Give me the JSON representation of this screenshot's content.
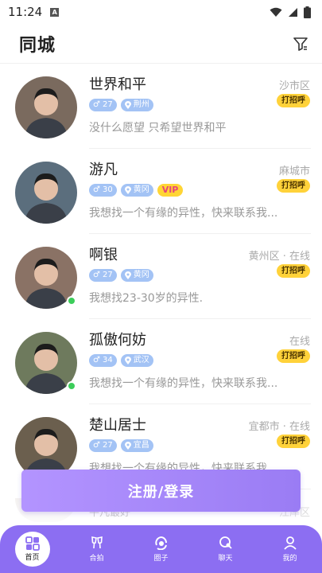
{
  "status": {
    "time": "11:24",
    "indicator": "A"
  },
  "header": {
    "title": "同城"
  },
  "users": [
    {
      "name": "世界和平",
      "location": "沙市区",
      "greet": "打招呼",
      "age": "27",
      "city": "荆州",
      "vip": false,
      "vip_label": "",
      "online": false,
      "signature": "没什么愿望 只希望世界和平",
      "avatar_bg": "#7a6a5e"
    },
    {
      "name": "游凡",
      "location": "麻城市",
      "greet": "打招呼",
      "age": "30",
      "city": "黄冈",
      "vip": true,
      "vip_label": "VIP",
      "online": false,
      "signature": "我想找一个有缘的异性，快来联系我...",
      "avatar_bg": "#5b6e7d"
    },
    {
      "name": "啊银",
      "location": "黄州区 · 在线",
      "greet": "打招呼",
      "age": "27",
      "city": "黄冈",
      "vip": false,
      "vip_label": "",
      "online": true,
      "signature": "我想找23-30岁的异性.",
      "avatar_bg": "#8a7265"
    },
    {
      "name": "孤傲何妨",
      "location": "在线",
      "greet": "打招呼",
      "age": "34",
      "city": "武汉",
      "vip": false,
      "vip_label": "",
      "online": true,
      "signature": "我想找一个有缘的异性，快来联系我...",
      "avatar_bg": "#6e7a5d"
    },
    {
      "name": "楚山居士",
      "location": "宜都市 · 在线",
      "greet": "打招呼",
      "age": "27",
      "city": "宜昌",
      "vip": false,
      "vip_label": "",
      "online": false,
      "signature": "我想找一个有缘的异性，快来联系我...",
      "avatar_bg": "#6b5f4e"
    }
  ],
  "faded_row": {
    "text": "平凡最好",
    "location": "江岸区"
  },
  "login_button": "注册/登录",
  "tabs": [
    {
      "label": "首页",
      "icon": "home-icon",
      "active": true
    },
    {
      "label": "合拍",
      "icon": "cheers-icon",
      "active": false
    },
    {
      "label": "圈子",
      "icon": "circle-icon",
      "active": false
    },
    {
      "label": "聊天",
      "icon": "chat-icon",
      "active": false
    },
    {
      "label": "我的",
      "icon": "profile-icon",
      "active": false
    }
  ],
  "colors": {
    "accent": "#8c6ef2",
    "greet_bg": "#ffd23a",
    "tag_bg": "#a3c3f5",
    "online": "#3ccd5a"
  }
}
